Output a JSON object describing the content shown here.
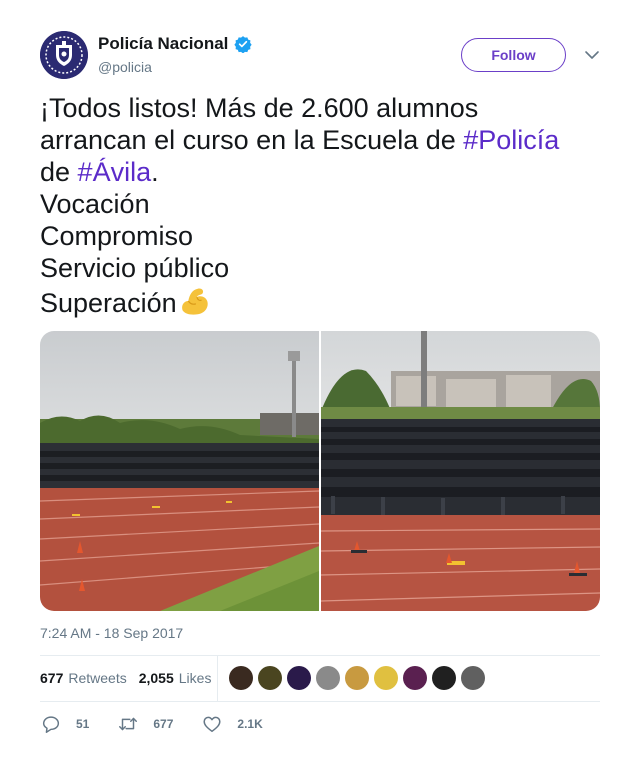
{
  "account": {
    "display_name": "Policía Nacional",
    "handle": "@policia",
    "verified": true,
    "avatar_color": "#2b2a72"
  },
  "follow_button": {
    "label": "Follow",
    "color": "#6b3fc8"
  },
  "tweet": {
    "line1_a": "¡Todos listos! Más de 2.600 alumnos",
    "line2_a": "arrancan el curso en la Escuela de ",
    "hashtag1": "#Policía",
    "line3_a": "de ",
    "hashtag2": "#Ávila",
    "line3_b": ".",
    "line4": "Vocación",
    "line5": "Compromiso",
    "line6": "Servicio público",
    "line7": "Superación",
    "emoji": "flexed-biceps",
    "hashtag_color": "#5b2bc9"
  },
  "media": {
    "photos": [
      {
        "description_icon": "police-formation-photo-left"
      },
      {
        "description_icon": "police-formation-photo-right"
      }
    ]
  },
  "timestamp": "7:24 AM - 18 Sep 2017",
  "stats": {
    "retweets_count": "677",
    "retweets_label": "Retweets",
    "likes_count": "2,055",
    "likes_label": "Likes"
  },
  "likers": [
    {
      "icon": "liker-avatar",
      "color": "#3a2a20"
    },
    {
      "icon": "liker-avatar",
      "color": "#4a4520"
    },
    {
      "icon": "liker-avatar",
      "color": "#2a1a4a"
    },
    {
      "icon": "liker-avatar",
      "color": "#8a8a8a"
    },
    {
      "icon": "liker-avatar",
      "color": "#c89a40"
    },
    {
      "icon": "liker-avatar",
      "color": "#e0c040"
    },
    {
      "icon": "liker-avatar",
      "color": "#5a2050"
    },
    {
      "icon": "liker-avatar",
      "color": "#202020"
    },
    {
      "icon": "liker-avatar",
      "color": "#606060"
    }
  ],
  "actions": {
    "reply_count": "51",
    "retweet_count": "677",
    "like_count": "2.1K"
  }
}
